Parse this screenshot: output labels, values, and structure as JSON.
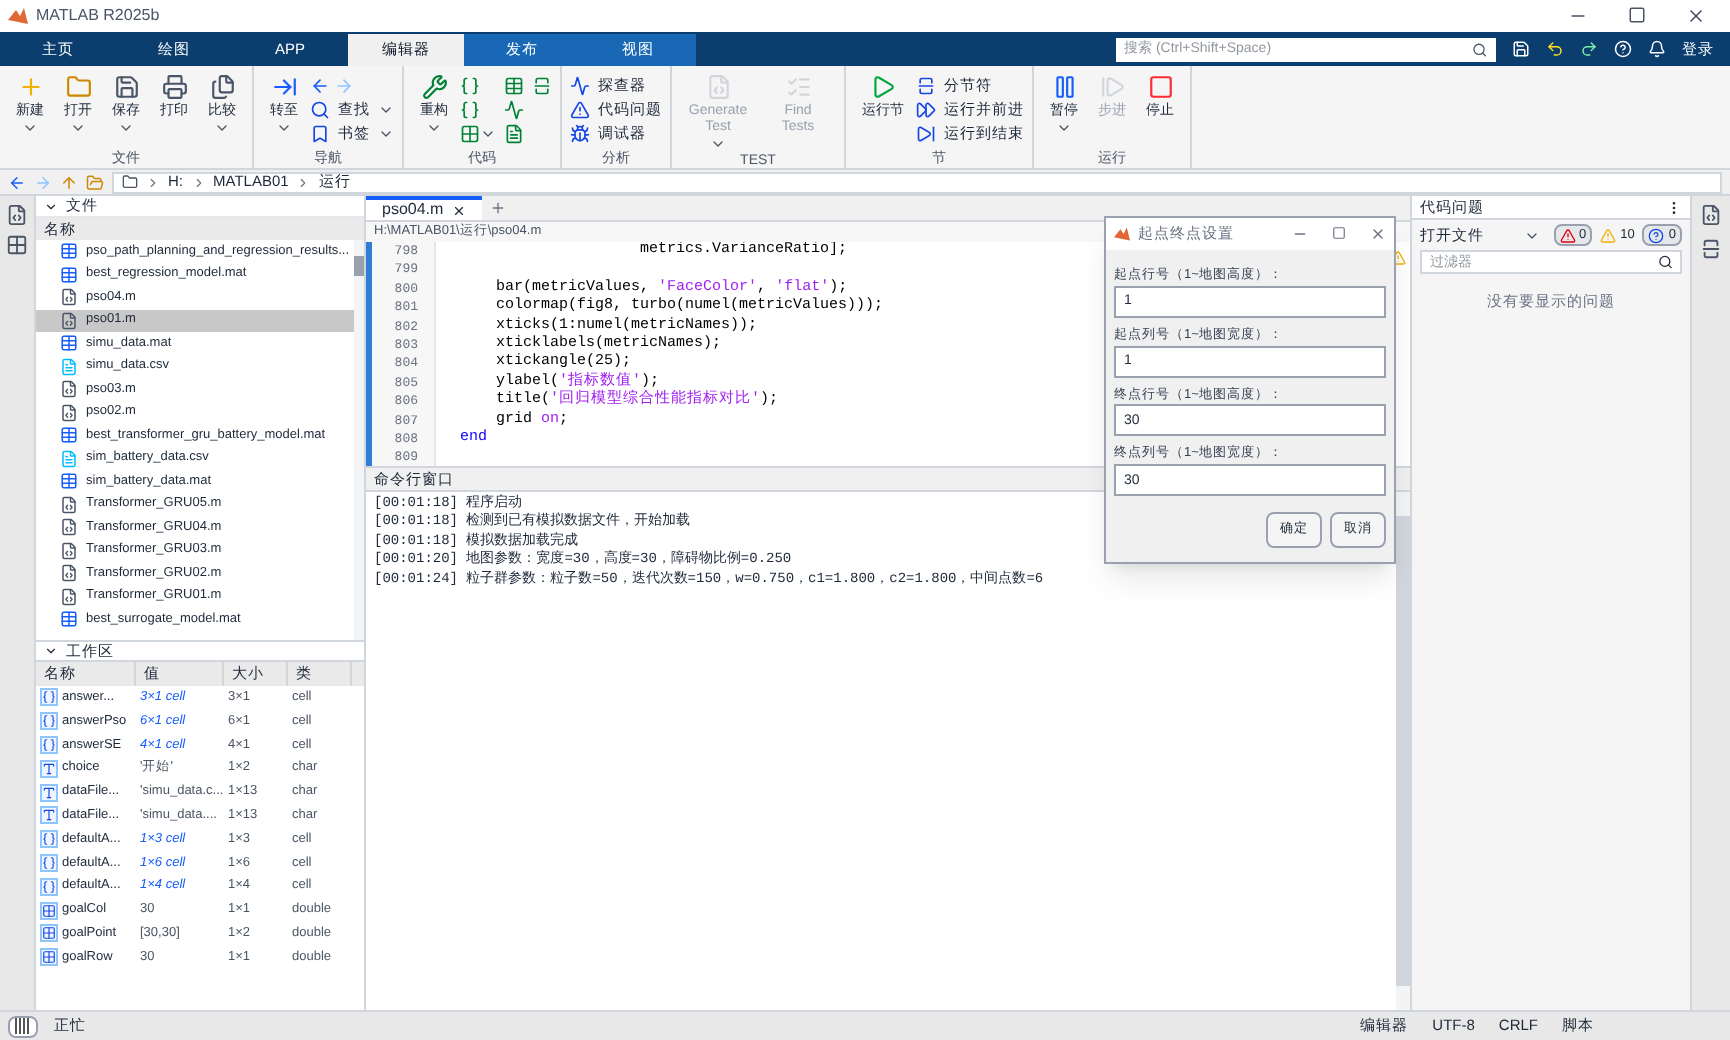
{
  "window": {
    "title": "MATLAB R2025b"
  },
  "tabs": [
    {
      "label": "主页",
      "selected": false,
      "contextual": false
    },
    {
      "label": "绘图",
      "selected": false,
      "contextual": false
    },
    {
      "label": "APP",
      "selected": false,
      "contextual": false
    },
    {
      "label": "编辑器",
      "selected": true
    },
    {
      "label": "发布",
      "selected": false,
      "contextual": true
    },
    {
      "label": "视图",
      "selected": false,
      "contextual": true
    }
  ],
  "search": {
    "placeholder": "搜索 (Ctrl+Shift+Space)"
  },
  "login": "登录",
  "ribbon": [
    {
      "label": "文件",
      "items": [
        {
          "kind": "large",
          "label": "新建",
          "menu": true
        },
        {
          "kind": "large",
          "label": "打开",
          "menu": true
        },
        {
          "kind": "large",
          "label": "保存",
          "menu": true
        },
        {
          "kind": "large",
          "label": "打印"
        },
        {
          "kind": "large",
          "label": "比较",
          "menu": true
        }
      ]
    },
    {
      "label": "导航",
      "items": [
        {
          "kind": "large",
          "label": "转至",
          "menu": true
        },
        {
          "kind": "arrows"
        },
        {
          "kind": "small",
          "label": "查找",
          "menu": true
        },
        {
          "kind": "small",
          "label": "书签",
          "menu": true
        }
      ]
    },
    {
      "label": "代码",
      "items": [
        {
          "kind": "large",
          "label": "重构",
          "menu": true
        },
        {
          "kind": "icon"
        },
        {
          "kind": "icon"
        },
        {
          "kind": "icon",
          "menu": true
        },
        {
          "kind": "icon"
        },
        {
          "kind": "icon"
        },
        {
          "kind": "icon"
        },
        {
          "kind": "icon"
        }
      ]
    },
    {
      "label": "分析",
      "items": [
        {
          "kind": "small",
          "label": "探查器"
        },
        {
          "kind": "small",
          "label": "代码问题"
        },
        {
          "kind": "small",
          "label": "调试器"
        }
      ]
    },
    {
      "label": "TEST",
      "items": [
        {
          "kind": "large",
          "label": "Generate Test",
          "menu": true,
          "disabled": true
        },
        {
          "kind": "large",
          "label": "Find Tests",
          "disabled": true
        }
      ]
    },
    {
      "label": "节",
      "items": [
        {
          "kind": "large",
          "label": "运行节"
        },
        {
          "kind": "small",
          "label": "分节符"
        },
        {
          "kind": "small",
          "label": "运行并前进"
        },
        {
          "kind": "small",
          "label": "运行到结束"
        }
      ]
    },
    {
      "label": "运行",
      "items": [
        {
          "kind": "large",
          "label": "暂停",
          "menu": true
        },
        {
          "kind": "large",
          "label": "步进",
          "disabled": true
        },
        {
          "kind": "large",
          "label": "停止"
        }
      ]
    }
  ],
  "address": [
    "H:",
    "MATLAB01",
    "运行"
  ],
  "files": {
    "title": "文件",
    "column": "名称",
    "items": [
      {
        "name": "pso_path_planning_and_regression_results...",
        "kind": "mat",
        "selected": false
      },
      {
        "name": "best_regression_model.mat",
        "kind": "mat",
        "selected": false
      },
      {
        "name": "pso04.m",
        "kind": "m",
        "selected": false
      },
      {
        "name": "pso01.m",
        "kind": "m",
        "selected": true
      },
      {
        "name": "simu_data.mat",
        "kind": "mat",
        "selected": false
      },
      {
        "name": "simu_data.csv",
        "kind": "csv",
        "selected": false
      },
      {
        "name": "pso03.m",
        "kind": "m",
        "selected": false
      },
      {
        "name": "pso02.m",
        "kind": "m",
        "selected": false
      },
      {
        "name": "best_transformer_gru_battery_model.mat",
        "kind": "mat",
        "selected": false
      },
      {
        "name": "sim_battery_data.csv",
        "kind": "csv",
        "selected": false
      },
      {
        "name": "sim_battery_data.mat",
        "kind": "mat",
        "selected": false
      },
      {
        "name": "Transformer_GRU05.m",
        "kind": "m",
        "selected": false
      },
      {
        "name": "Transformer_GRU04.m",
        "kind": "m",
        "selected": false
      },
      {
        "name": "Transformer_GRU03.m",
        "kind": "m",
        "selected": false
      },
      {
        "name": "Transformer_GRU02.m",
        "kind": "m",
        "selected": false
      },
      {
        "name": "Transformer_GRU01.m",
        "kind": "m",
        "selected": false
      },
      {
        "name": "best_surrogate_model.mat",
        "kind": "mat",
        "selected": false
      }
    ]
  },
  "workspace": {
    "title": "工作区",
    "columns": [
      "名称",
      "值",
      "大小",
      "类"
    ],
    "rows": [
      {
        "kind": "cell",
        "cells": [
          "answer...",
          "3×1 cell",
          "3×1",
          "cell"
        ]
      },
      {
        "kind": "cell",
        "cells": [
          "answerPso",
          "6×1 cell",
          "6×1",
          "cell"
        ]
      },
      {
        "kind": "cell",
        "cells": [
          "answerSE",
          "4×1 cell",
          "4×1",
          "cell"
        ]
      },
      {
        "kind": "char",
        "cells": [
          "choice",
          "'开始'",
          "1×2",
          "char"
        ]
      },
      {
        "kind": "char",
        "cells": [
          "dataFile...",
          "'simu_data.c...",
          "1×13",
          "char"
        ]
      },
      {
        "kind": "char",
        "cells": [
          "dataFile...",
          "'simu_data....",
          "1×13",
          "char"
        ]
      },
      {
        "kind": "cell",
        "cells": [
          "defaultA...",
          "1×3 cell",
          "1×3",
          "cell"
        ]
      },
      {
        "kind": "cell",
        "cells": [
          "defaultA...",
          "1×6 cell",
          "1×6",
          "cell"
        ]
      },
      {
        "kind": "cell",
        "cells": [
          "defaultA...",
          "1×4 cell",
          "1×4",
          "cell"
        ]
      },
      {
        "kind": "numeric",
        "cells": [
          "goalCol",
          "30",
          "1×1",
          "double"
        ]
      },
      {
        "kind": "numeric",
        "cells": [
          "goalPoint",
          "[30,30]",
          "1×2",
          "double"
        ]
      },
      {
        "kind": "numeric",
        "cells": [
          "goalRow",
          "30",
          "1×1",
          "double"
        ]
      }
    ]
  },
  "editor": {
    "tabs": [
      {
        "label": "pso04.m",
        "selected": true
      }
    ],
    "path": "H:\\MATLAB01\\运行\\pso04.m",
    "lines": [
      {
        "number": "798",
        "segments": [
          {
            "kind": "plain",
            "text": "                    metrics.VarianceRatio];"
          }
        ]
      },
      {
        "number": "799"
      },
      {
        "number": "800",
        "segments": [
          {
            "kind": "plain",
            "text": "    bar(metricValues, "
          },
          {
            "kind": "string",
            "text": "'FaceColor'"
          },
          {
            "kind": "plain",
            "text": ", "
          },
          {
            "kind": "string",
            "text": "'flat'"
          },
          {
            "kind": "plain",
            "text": ");"
          }
        ]
      },
      {
        "number": "801",
        "segments": [
          {
            "kind": "plain",
            "text": "    colormap(fig8, turbo(numel(metricValues)));"
          }
        ]
      },
      {
        "number": "802",
        "segments": [
          {
            "kind": "plain",
            "text": "    xticks(1:numel(metricNames));"
          }
        ]
      },
      {
        "number": "803",
        "segments": [
          {
            "kind": "plain",
            "text": "    xticklabels(metricNames);"
          }
        ]
      },
      {
        "number": "804",
        "segments": [
          {
            "kind": "plain",
            "text": "    xtickangle(25);"
          }
        ]
      },
      {
        "number": "805",
        "segments": [
          {
            "kind": "plain",
            "text": "    ylabel("
          },
          {
            "kind": "string",
            "text": "'指标数值'"
          },
          {
            "kind": "plain",
            "text": ");"
          }
        ]
      },
      {
        "number": "806",
        "segments": [
          {
            "kind": "plain",
            "text": "    title("
          },
          {
            "kind": "string",
            "text": "'回归模型综合性能指标对比'"
          },
          {
            "kind": "plain",
            "text": ");"
          }
        ]
      },
      {
        "number": "807",
        "segments": [
          {
            "kind": "plain",
            "text": "    grid "
          },
          {
            "kind": "string",
            "text": "on"
          },
          {
            "kind": "plain",
            "text": ";"
          }
        ]
      },
      {
        "number": "808",
        "segments": [
          {
            "kind": "keyword",
            "text": "end"
          }
        ]
      },
      {
        "number": "809"
      }
    ]
  },
  "command_window": {
    "title": "命令行窗口",
    "lines": [
      "[00:01:18] 程序启动",
      "[00:01:18] 检测到已有模拟数据文件，开始加载",
      "[00:01:18] 模拟数据加载完成",
      "[00:01:20] 地图参数：宽度=30，高度=30，障碍物比例=0.250",
      "[00:01:24] 粒子群参数：粒子数=50，迭代次数=150，w=0.750，c1=1.800，c2=1.800，中间点数=6"
    ]
  },
  "dialog": {
    "title": "起点终点设置",
    "fields": [
      {
        "label": "起点行号（1~地图高度）：",
        "value": "1"
      },
      {
        "label": "起点列号（1~地图宽度）：",
        "value": "1"
      },
      {
        "label": "终点行号（1~地图高度）：",
        "value": "30"
      },
      {
        "label": "终点列号（1~地图宽度）：",
        "value": "30"
      }
    ],
    "buttons": [
      "确定",
      "取消"
    ]
  },
  "code_issues": {
    "title": "代码问题",
    "scope": "打开文件",
    "counts": [
      {
        "kind": "error",
        "value": "0"
      },
      {
        "kind": "warning",
        "value": "10"
      },
      {
        "kind": "info",
        "value": "0"
      }
    ],
    "filter": {
      "placeholder": "过滤器"
    },
    "message": "没有要显示的问题"
  },
  "status_bar": {
    "state": "正忙",
    "items": [
      "编辑器",
      "UTF-8",
      "CRLF",
      "脚本"
    ]
  }
}
